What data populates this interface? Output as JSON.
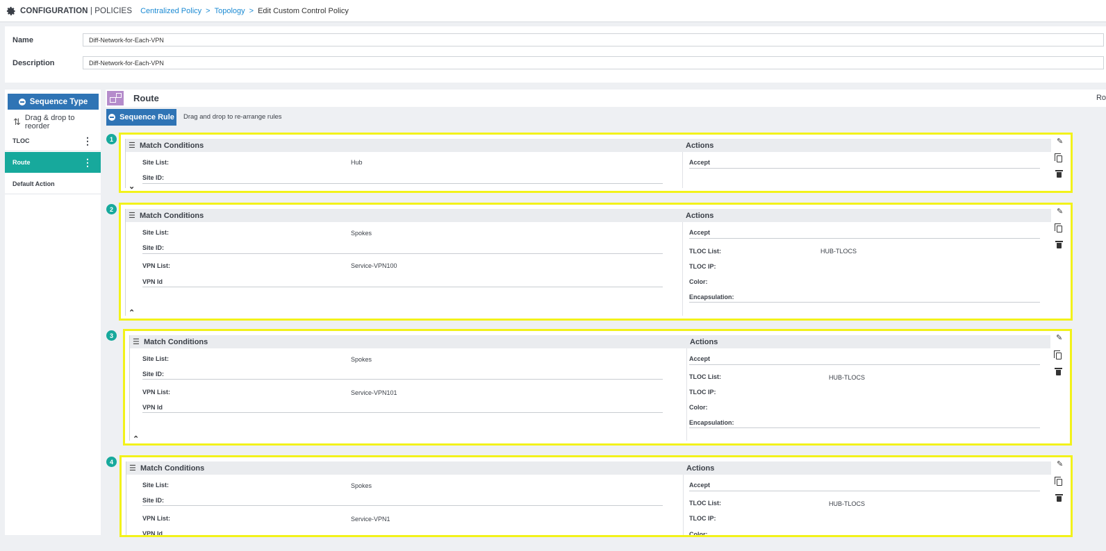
{
  "header": {
    "icon": "gear-icon",
    "title_main": "CONFIGURATION",
    "title_sep": " | ",
    "title_sub": "POLICIES",
    "breadcrumbs": [
      "Centralized Policy",
      "Topology"
    ],
    "breadcrumb_sep": ">",
    "current_page": "Edit Custom Control Policy"
  },
  "form": {
    "name_label": "Name",
    "name_value": "Diff-Network-for-Each-VPN",
    "description_label": "Description",
    "description_value": "Diff-Network-for-Each-VPN"
  },
  "sidebar": {
    "sequence_type_label": "Sequence Type",
    "drag_reorder_label": "Drag & drop to reorder",
    "items": [
      {
        "label": "TLOC",
        "active": false,
        "has_menu": true
      },
      {
        "label": "Route",
        "active": true,
        "has_menu": true
      },
      {
        "label": "Default Action",
        "active": false,
        "has_menu": false
      }
    ]
  },
  "main": {
    "section_title": "Route",
    "section_right_label": "Ro",
    "sequence_rule_label": "Sequence Rule",
    "sequence_rule_hint": "Drag and drop to re-arrange rules",
    "match_conditions_label": "Match Conditions",
    "actions_label": "Actions",
    "rules": [
      {
        "number": "1",
        "expanded": false,
        "match": [
          {
            "label": "Site List:",
            "value": "Hub"
          },
          {
            "label": "Site ID:",
            "value": ""
          }
        ],
        "actions": [
          {
            "label": "Accept",
            "value": ""
          }
        ]
      },
      {
        "number": "2",
        "expanded": true,
        "match": [
          {
            "label": "Site List:",
            "value": "Spokes"
          },
          {
            "label": "Site ID:",
            "value": ""
          },
          {
            "label": "VPN List:",
            "value": "Service-VPN100"
          },
          {
            "label": "VPN Id",
            "value": ""
          }
        ],
        "actions": [
          {
            "label": "Accept",
            "value": ""
          },
          {
            "label": "TLOC List:",
            "value": "HUB-TLOCS"
          },
          {
            "label": "TLOC IP:",
            "value": ""
          },
          {
            "label": "Color:",
            "value": ""
          },
          {
            "label": "Encapsulation:",
            "value": ""
          }
        ]
      },
      {
        "number": "3",
        "expanded": true,
        "match": [
          {
            "label": "Site List:",
            "value": "Spokes"
          },
          {
            "label": "Site ID:",
            "value": ""
          },
          {
            "label": "VPN List:",
            "value": "Service-VPN101"
          },
          {
            "label": "VPN Id",
            "value": ""
          }
        ],
        "actions": [
          {
            "label": "Accept",
            "value": ""
          },
          {
            "label": "TLOC List:",
            "value": "HUB-TLOCS"
          },
          {
            "label": "TLOC IP:",
            "value": ""
          },
          {
            "label": "Color:",
            "value": ""
          },
          {
            "label": "Encapsulation:",
            "value": ""
          }
        ]
      },
      {
        "number": "4",
        "expanded": true,
        "match": [
          {
            "label": "Site List:",
            "value": "Spokes"
          },
          {
            "label": "Site ID:",
            "value": ""
          },
          {
            "label": "VPN List:",
            "value": "Service-VPN1"
          },
          {
            "label": "VPN Id",
            "value": ""
          }
        ],
        "actions": [
          {
            "label": "Accept",
            "value": ""
          },
          {
            "label": "TLOC List:",
            "value": "HUB-TLOCS"
          },
          {
            "label": "TLOC IP:",
            "value": ""
          },
          {
            "label": "Color:",
            "value": ""
          }
        ]
      }
    ]
  },
  "colors": {
    "primary_button": "#2f74b5",
    "active_teal": "#17a99c",
    "highlight_yellow": "#f2f21a",
    "link_blue": "#1b8ad3",
    "route_icon": "#b58ccb"
  }
}
